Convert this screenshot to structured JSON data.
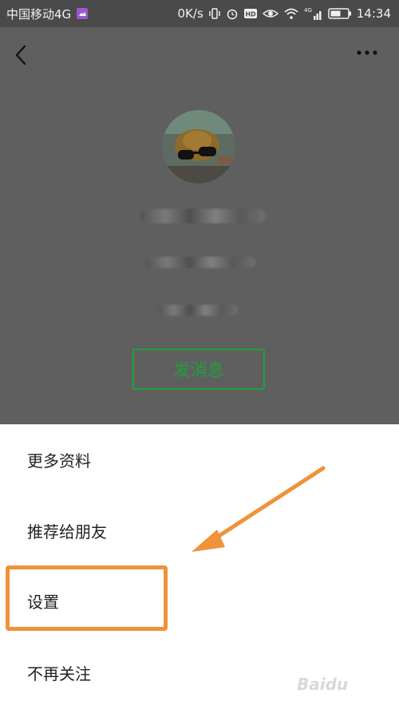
{
  "status_bar": {
    "carrier": "中国移动4G",
    "speed": "0K/s",
    "network": "4G",
    "time": "14:34",
    "icons": [
      "photo-icon",
      "vibrate-icon",
      "alarm-icon",
      "hd-icon",
      "eye-icon",
      "wifi-icon",
      "signal-icon",
      "battery-icon"
    ]
  },
  "profile": {
    "send_message_label": "发消息"
  },
  "menu": {
    "items": [
      {
        "label": "更多资料"
      },
      {
        "label": "推荐给朋友"
      },
      {
        "label": "设置"
      },
      {
        "label": "不再关注"
      }
    ]
  },
  "watermark": {
    "text": "Baidu"
  },
  "colors": {
    "accent_green": "#1aa33a",
    "highlight_orange": "#f0923a"
  }
}
